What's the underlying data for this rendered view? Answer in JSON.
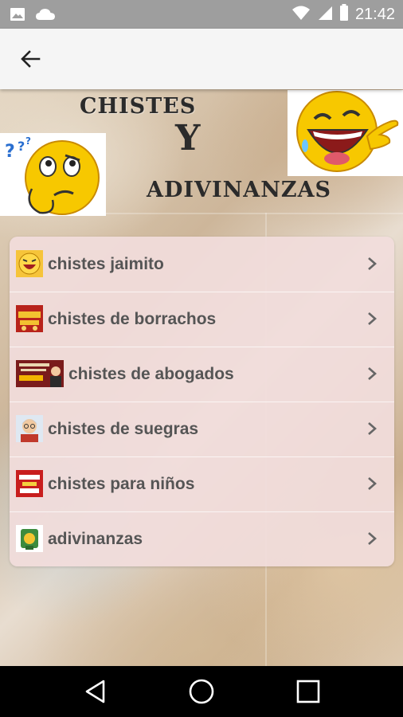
{
  "status_bar": {
    "time": "21:42",
    "icons": [
      "image-icon",
      "cloud-icon",
      "wifi-icon",
      "signal-icon",
      "battery-icon"
    ]
  },
  "app_bar": {
    "back_icon": "arrow-left-icon"
  },
  "banner": {
    "line1": "CHISTES",
    "line2": "Y",
    "line3": "ADIVINANZAS"
  },
  "menu": {
    "items": [
      {
        "label": "chistes jaimito",
        "icon": "laughing-face-thumbnail"
      },
      {
        "label": "chistes de borrachos",
        "icon": "drunk-jokes-thumbnail"
      },
      {
        "label": "chistes de abogados",
        "icon": "lawyer-jokes-thumbnail"
      },
      {
        "label": "chistes de suegras",
        "icon": "mother-in-law-thumbnail"
      },
      {
        "label": "chistes para niños",
        "icon": "kids-jokes-thumbnail"
      },
      {
        "label": "adivinanzas",
        "icon": "riddles-thumbnail"
      }
    ]
  },
  "nav_bar": {
    "buttons": [
      "back-triangle-icon",
      "home-circle-icon",
      "recents-square-icon"
    ]
  }
}
